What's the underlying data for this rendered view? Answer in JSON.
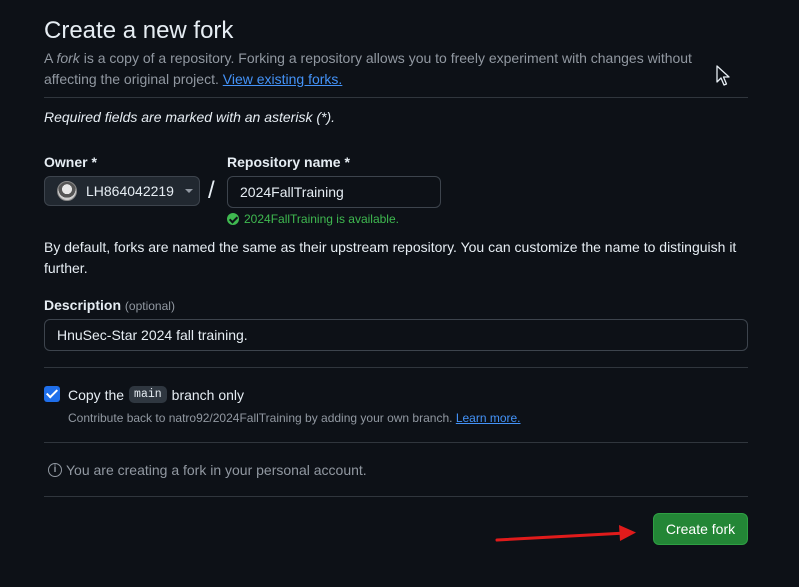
{
  "header": {
    "title": "Create a new fork",
    "intro_prefix": "A ",
    "intro_em": "fork",
    "intro_rest": " is a copy of a repository. Forking a repository allows you to freely experiment with changes without affecting the original project. ",
    "view_forks_link": "View existing forks."
  },
  "form": {
    "required_note": "Required fields are marked with an asterisk (*).",
    "owner_label": "Owner *",
    "owner_value": "LH864042219",
    "slash": "/",
    "repo_label": "Repository name *",
    "repo_value": "2024FallTraining",
    "availability": "2024FallTraining is available.",
    "helper": "By default, forks are named the same as their upstream repository. You can customize the name to distinguish it further.",
    "description_label": "Description",
    "description_optional": "(optional)",
    "description_value": "HnuSec-Star 2024 fall training.",
    "copy_checked": true,
    "copy_prefix": "Copy the",
    "copy_code": "main",
    "copy_suffix": "branch only",
    "contrib_text": "Contribute back to natro92/2024FallTraining by adding your own branch.",
    "learn_more": "Learn more.",
    "info_text": "You are creating a fork in your personal account.",
    "create_button": "Create fork"
  },
  "colors": {
    "background": "#0d1117",
    "accent_blue": "#1f6feb",
    "link": "#4493f8",
    "success_green": "#3fb950",
    "primary_button": "#238636",
    "annotation_arrow": "#e01b1b"
  },
  "icons": [
    "avatar",
    "caret-down-icon",
    "check-circle-icon",
    "checkbox-check-icon",
    "info-icon",
    "mouse-cursor-icon",
    "red-arrow-annotation"
  ]
}
